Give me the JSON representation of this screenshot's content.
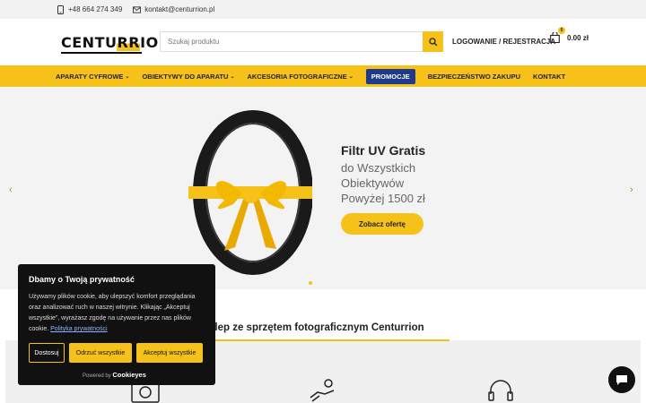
{
  "topbar": {
    "phone": "+48 664 274 349",
    "email": "kontakt@centurrion.pl"
  },
  "header": {
    "logo_pre": "CENTU",
    "logo_rr": "RR",
    "logo_post": "ION",
    "search_placeholder": "Szukaj produktu",
    "login_label": "LOGOWANIE / REJESTRACJA",
    "cart_count": "0",
    "cart_total": "0.00 zł"
  },
  "nav": {
    "items": [
      {
        "label": "APARATY CYFROWE"
      },
      {
        "label": "OBIEKTYWY DO APARATU"
      },
      {
        "label": "AKCESORIA FOTOGRAFICZNE"
      },
      {
        "label": "PROMOCJE"
      },
      {
        "label": "BEZPIECZEŃSTWO ZAKUPU"
      },
      {
        "label": "KONTAKT"
      }
    ]
  },
  "hero": {
    "title": "Filtr UV Gratis",
    "line1": "do Wszystkich",
    "line2": "Obiektywów",
    "line3": "Powyżej 1500 zł",
    "cta": "Zobacz ofertę",
    "prev_arrow": "‹",
    "next_arrow": "›"
  },
  "section": {
    "title": "klep ze sprzętem fotograficznym Centurrion"
  },
  "cookie": {
    "title": "Dbamy o Twoją prywatność",
    "body": "Używamy plików cookie, aby ulepszyć komfort przeglądania oraz analizować ruch w naszej witrynie. Klikając „Akceptuj wszystkie”, wyrażasz zgodę na używanie przez nas plików cookie.",
    "policy_link": "Polityka prywatności",
    "btn_customize": "Dostosuj",
    "btn_reject": "Odrzuć wszystkie",
    "btn_accept": "Akceptuj wszystkie",
    "powered": "Powered by",
    "brand": "Cookieyes"
  },
  "colors": {
    "accent": "#f6c21a",
    "promo": "#1e3a8a"
  }
}
